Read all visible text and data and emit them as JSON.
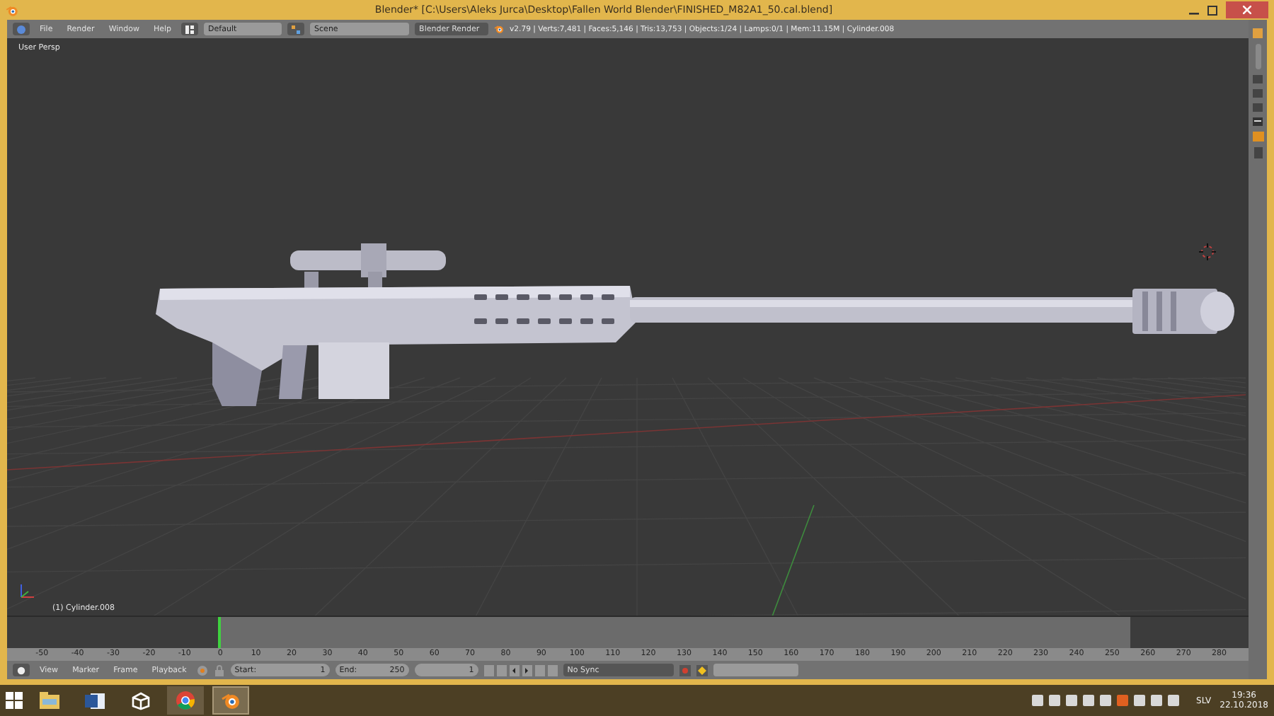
{
  "window": {
    "title": "Blender* [C:\\Users\\Aleks Jurca\\Desktop\\Fallen World Blender\\FINISHED_M82A1_50.cal.blend]"
  },
  "header": {
    "menus": [
      "File",
      "Render",
      "Window",
      "Help"
    ],
    "layout": "Default",
    "scene": "Scene",
    "engine": "Blender Render",
    "stats": "v2.79 | Verts:7,481 | Faces:5,146 | Tris:13,753 | Objects:1/24 | Lamps:0/1 | Mem:11.15M | Cylinder.008"
  },
  "viewport": {
    "view_label": "User Persp",
    "object_label": "(1) Cylinder.008"
  },
  "timeline": {
    "ruler": [
      "-50",
      "-40",
      "-30",
      "-20",
      "-10",
      "0",
      "10",
      "20",
      "30",
      "40",
      "50",
      "60",
      "70",
      "80",
      "90",
      "100",
      "110",
      "120",
      "130",
      "140",
      "150",
      "160",
      "170",
      "180",
      "190",
      "200",
      "210",
      "220",
      "230",
      "240",
      "250",
      "260",
      "270",
      "280"
    ]
  },
  "timeline_header": {
    "menus": [
      "View",
      "Marker",
      "Frame",
      "Playback"
    ],
    "start_label": "Start:",
    "start": "1",
    "end_label": "End:",
    "end": "250",
    "current": "1",
    "sync": "No Sync"
  },
  "taskbar": {
    "apps": [
      {
        "kind": "folder",
        "running": false,
        "selected": false
      },
      {
        "kind": "word",
        "running": false,
        "selected": false
      },
      {
        "kind": "unity",
        "running": false,
        "selected": false
      },
      {
        "kind": "chrome",
        "running": true,
        "selected": false
      },
      {
        "kind": "blender",
        "running": true,
        "selected": true
      }
    ],
    "language": "SLV",
    "time": "19:36",
    "date": "22.10.2018"
  }
}
